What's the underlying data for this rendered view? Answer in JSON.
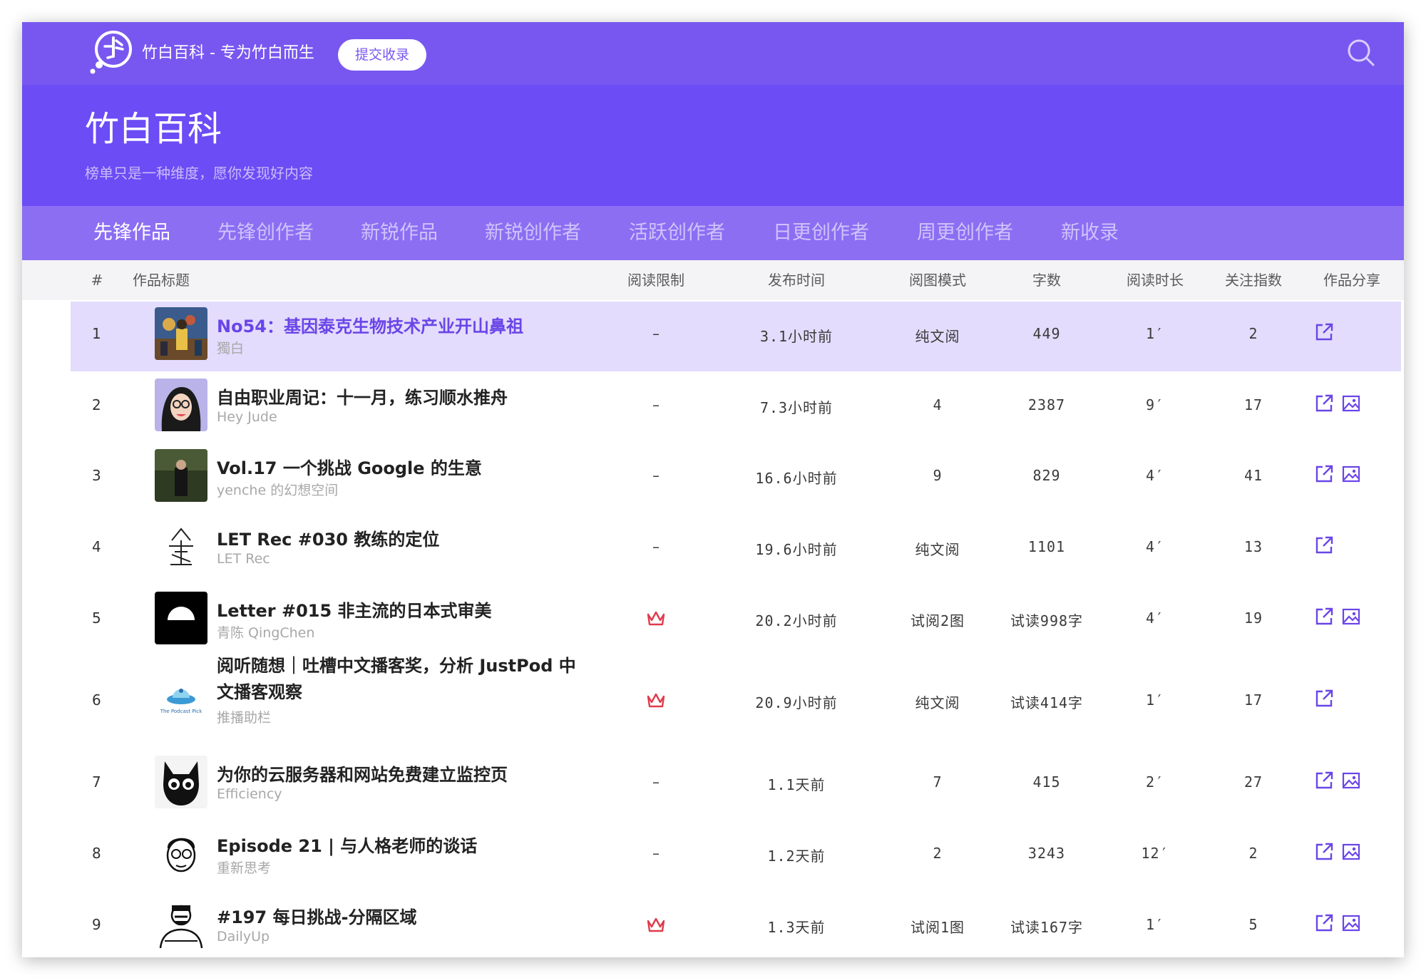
{
  "header": {
    "brand": "竹白百科 - 专为竹白而生",
    "submit_label": "提交收录",
    "logo_icon": "bamboo-logo-icon",
    "search_icon": "search-icon"
  },
  "hero": {
    "title": "竹白百科",
    "subtitle": "榜单只是一种维度，愿你发现好内容"
  },
  "tabs": [
    {
      "label": "先锋作品"
    },
    {
      "label": "先锋创作者"
    },
    {
      "label": "新锐作品"
    },
    {
      "label": "新锐创作者"
    },
    {
      "label": "活跃创作者"
    },
    {
      "label": "日更创作者"
    },
    {
      "label": "周更创作者"
    },
    {
      "label": "新收录"
    }
  ],
  "active_tab": "先锋作品",
  "table": {
    "headers": {
      "rank": "#",
      "title": "作品标题",
      "limit": "阅读限制",
      "time": "发布时间",
      "mode": "阅图模式",
      "words": "字数",
      "duration": "阅读时长",
      "follow": "关注指数",
      "share": "作品分享"
    },
    "rows": [
      {
        "rank": "1",
        "title": "No54：基因泰克生物技术产业开山鼻祖",
        "author": "獨白",
        "limit": "–",
        "time": "3.1小时前",
        "mode": "纯文阅",
        "words": "449",
        "duration": "1′",
        "follow": "2",
        "share_link": true,
        "share_image": false,
        "premium": false
      },
      {
        "rank": "2",
        "title": "自由职业周记：十一月，练习顺水推舟",
        "author": "Hey Jude",
        "limit": "–",
        "time": "7.3小时前",
        "mode": "4",
        "words": "2387",
        "duration": "9′",
        "follow": "17",
        "share_link": true,
        "share_image": true,
        "premium": false
      },
      {
        "rank": "3",
        "title": "Vol.17 一个挑战 Google 的生意",
        "author": "yenche 的幻想空间",
        "limit": "–",
        "time": "16.6小时前",
        "mode": "9",
        "words": "829",
        "duration": "4′",
        "follow": "41",
        "share_link": true,
        "share_image": true,
        "premium": false
      },
      {
        "rank": "4",
        "title": "LET Rec #030 教练的定位",
        "author": "LET Rec",
        "limit": "–",
        "time": "19.6小时前",
        "mode": "纯文阅",
        "words": "1101",
        "duration": "4′",
        "follow": "13",
        "share_link": true,
        "share_image": false,
        "premium": false
      },
      {
        "rank": "5",
        "title": "Letter #015 非主流的日本式审美",
        "author": "青陈 QingChen",
        "limit": "",
        "time": "20.2小时前",
        "mode": "试阅2图",
        "words": "试读998字",
        "duration": "4′",
        "follow": "19",
        "share_link": true,
        "share_image": true,
        "premium": true
      },
      {
        "rank": "6",
        "title": "阅听随想｜吐槽中文播客奖，分析 JustPod 中文播客观察",
        "author": "推播助栏",
        "limit": "",
        "time": "20.9小时前",
        "mode": "纯文阅",
        "words": "试读414字",
        "duration": "1′",
        "follow": "17",
        "share_link": true,
        "share_image": false,
        "premium": true,
        "avatar_text": "The Podcast Pick"
      },
      {
        "rank": "7",
        "title": "为你的云服务器和网站免费建立监控页",
        "author": "Efficiency",
        "limit": "–",
        "time": "1.1天前",
        "mode": "7",
        "words": "415",
        "duration": "2′",
        "follow": "27",
        "share_link": true,
        "share_image": true,
        "premium": false
      },
      {
        "rank": "8",
        "title": "Episode 21 | 与人格老师的谈话",
        "author": "重新思考",
        "limit": "–",
        "time": "1.2天前",
        "mode": "2",
        "words": "3243",
        "duration": "12′",
        "follow": "2",
        "share_link": true,
        "share_image": true,
        "premium": false
      },
      {
        "rank": "9",
        "title": "#197 每日挑战-分隔区域",
        "author": "DailyUp",
        "limit": "",
        "time": "1.3天前",
        "mode": "试阅1图",
        "words": "试读167字",
        "duration": "1′",
        "follow": "5",
        "share_link": true,
        "share_image": true,
        "premium": true
      }
    ]
  },
  "colors": {
    "topbar": "#7857f0",
    "hero": "#6b4cf5",
    "tabs": "#8c6ef3",
    "highlight_row": "#e3dcfc",
    "accent": "#6a45e8",
    "premium": "#e03a4a"
  }
}
